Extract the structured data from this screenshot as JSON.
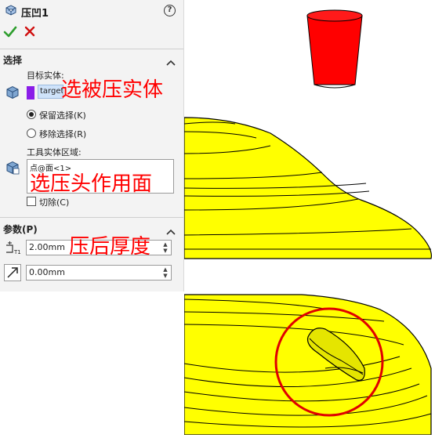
{
  "property_manager": {
    "title": "压凹1",
    "help": "?",
    "sections": {
      "selection": {
        "header": "选择",
        "target_body_label": "目标实体:",
        "target_body_item": "target",
        "keep_selection": "保留选择(K)",
        "remove_selection": "移除选择(R)",
        "tool_body_region_label": "工具实体区域:",
        "tool_body_item": "点@面<1>",
        "cut_label": "切除(C)"
      },
      "parameters": {
        "header": "参数(P)",
        "thickness_value": "2.00mm",
        "clearance_value": "0.00mm"
      }
    }
  },
  "annotations": {
    "target_note": "选被压实体",
    "tool_note": "选压头作用面",
    "thickness_note": "压后厚度"
  },
  "colors": {
    "part_yellow": "#ffff00",
    "tool_red": "#ff0000",
    "highlight_circle": "#e00000",
    "annotation": "#ff0000",
    "ok": "#2e9e2e",
    "cancel": "#d01010"
  },
  "icons": {
    "header": "indent-feature-icon",
    "ok": "check-icon",
    "cancel": "x-icon",
    "target": "body-cube-icon",
    "tool": "body-cube-icon",
    "thickness": "thickness-icon",
    "clearance": "arrow-diagonal-icon"
  }
}
